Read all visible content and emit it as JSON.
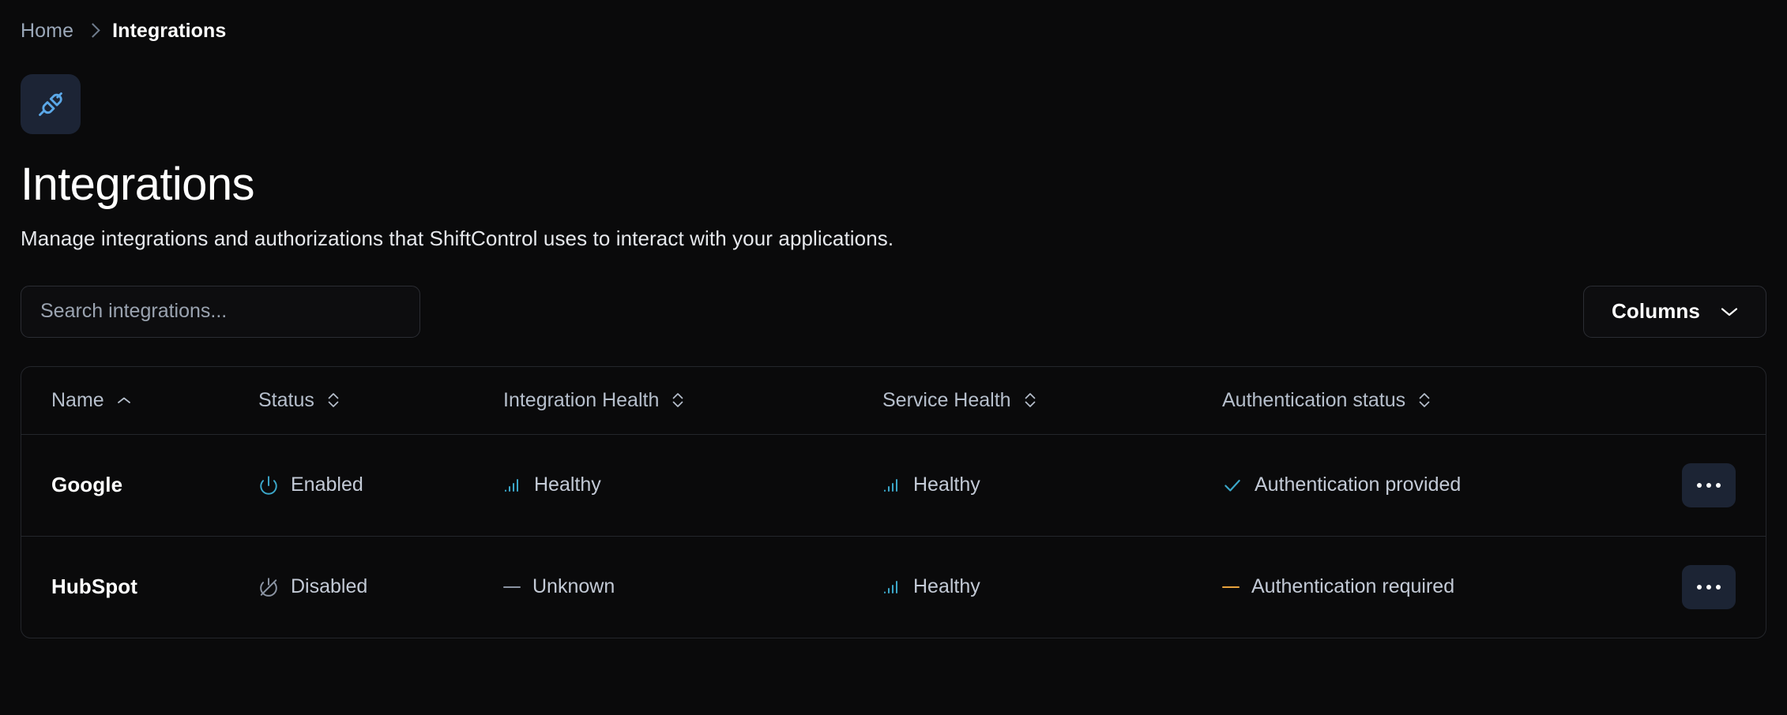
{
  "breadcrumb": {
    "home_label": "Home",
    "current_label": "Integrations",
    "separator_icon": "chevron-right-icon"
  },
  "header": {
    "badge_icon": "plug-connect-icon",
    "title": "Integrations",
    "subtitle": "Manage integrations and authorizations that ShiftControl uses to interact with your applications."
  },
  "toolbar": {
    "search_placeholder": "Search integrations...",
    "search_value": "",
    "columns_label": "Columns",
    "columns_icon": "chevron-down-icon"
  },
  "table": {
    "columns": [
      {
        "label": "Name",
        "sort_icon": "chevron-up-icon",
        "sorted": "asc"
      },
      {
        "label": "Status",
        "sort_icon": "chevron-updown-icon",
        "sorted": "none"
      },
      {
        "label": "Integration Health",
        "sort_icon": "chevron-updown-icon",
        "sorted": "none"
      },
      {
        "label": "Service Health",
        "sort_icon": "chevron-updown-icon",
        "sorted": "none"
      },
      {
        "label": "Authentication status",
        "sort_icon": "chevron-updown-icon",
        "sorted": "none"
      }
    ],
    "rows": [
      {
        "name": "Google",
        "status": {
          "label": "Enabled",
          "icon": "power-on-icon",
          "color": "#3ba7c9"
        },
        "integration_health": {
          "label": "Healthy",
          "icon": "signal-bars-icon",
          "color": "#3ba7c9"
        },
        "service_health": {
          "label": "Healthy",
          "icon": "signal-bars-icon",
          "color": "#3ba7c9"
        },
        "auth_status": {
          "label": "Authentication provided",
          "icon": "check-icon",
          "color": "#3ba7c9"
        },
        "actions_label": "..."
      },
      {
        "name": "HubSpot",
        "status": {
          "label": "Disabled",
          "icon": "power-off-icon",
          "color": "#8b94a3"
        },
        "integration_health": {
          "label": "Unknown",
          "icon": "dash-icon",
          "color": "#8b94a3"
        },
        "service_health": {
          "label": "Healthy",
          "icon": "signal-bars-icon",
          "color": "#3ba7c9"
        },
        "auth_status": {
          "label": "Authentication required",
          "icon": "dash-icon",
          "color": "#e8a33d"
        },
        "actions_label": "..."
      }
    ]
  },
  "colors": {
    "background": "#0a0a0b",
    "accent_cyan": "#3ba7c9",
    "accent_amber": "#e8a33d",
    "badge_bg": "#1c2435",
    "border": "#24262b",
    "text_primary": "#ffffff",
    "text_muted": "#b6bfcc"
  }
}
